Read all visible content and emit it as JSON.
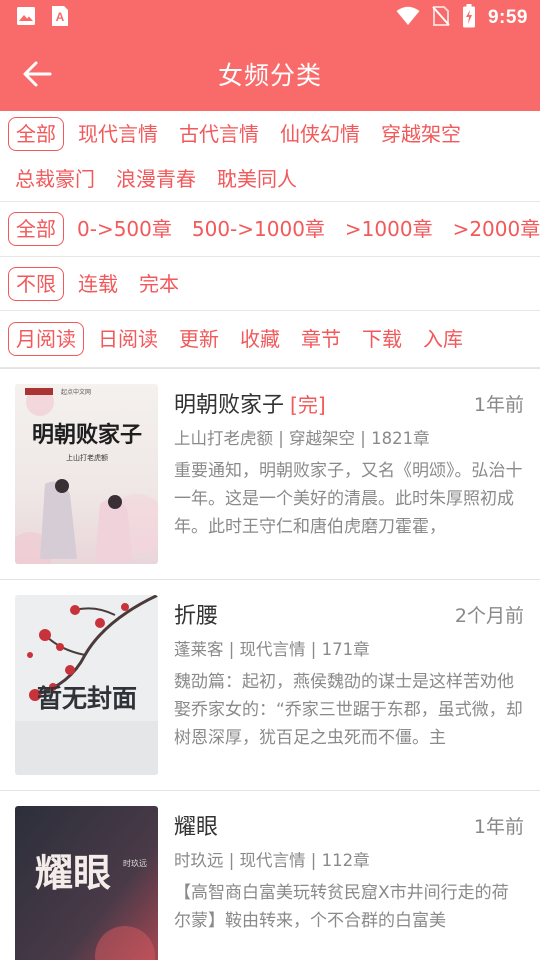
{
  "status_bar": {
    "time": "9:59"
  },
  "toolbar": {
    "title": "女频分类"
  },
  "filters": {
    "category": [
      "全部",
      "现代言情",
      "古代言情",
      "仙侠幻情",
      "穿越架空",
      "总裁豪门",
      "浪漫青春",
      "耽美同人"
    ],
    "chapters": [
      "全部",
      "0->500章",
      "500->1000章",
      ">1000章",
      ">2000章"
    ],
    "status": [
      "不限",
      "连载",
      "完本"
    ],
    "sort": [
      "月阅读",
      "日阅读",
      "更新",
      "收藏",
      "章节",
      "下载",
      "入库"
    ]
  },
  "books": [
    {
      "title": "明朝败家子",
      "tag": "[完]",
      "time": "1年前",
      "meta": "上山打老虎额 | 穿越架空 | 1821章",
      "desc": "重要通知，明朝败家子，又名《明颂》。弘治十一年。这是一个美好的清晨。此时朱厚照初成年。此时王守仁和唐伯虎磨刀霍霍，",
      "cover": {
        "title_text": "明朝败家子",
        "author_text": "上山打老虎额",
        "publisher_text": "起点中文网"
      }
    },
    {
      "title": "折腰",
      "tag": "",
      "time": "2个月前",
      "meta": "蓬莱客 | 现代言情 | 171章",
      "desc": "魏劭篇：起初，燕侯魏劭的谋士是这样苦劝他娶乔家女的：“乔家三世踞于东郡，虽式微，却树恩深厚，犹百足之虫死而不僵。主",
      "cover": {
        "title_text": "暂无封面"
      }
    },
    {
      "title": "耀眼",
      "tag": "",
      "time": "1年前",
      "meta": "时玖远 | 现代言情 | 112章",
      "desc": "【高智商白富美玩转贫民窟X市井间行走的荷尔蒙】鞍由转来，个不合群的白富美",
      "cover": {
        "title_text": "耀眼",
        "author_text": "时玖远"
      }
    }
  ]
}
